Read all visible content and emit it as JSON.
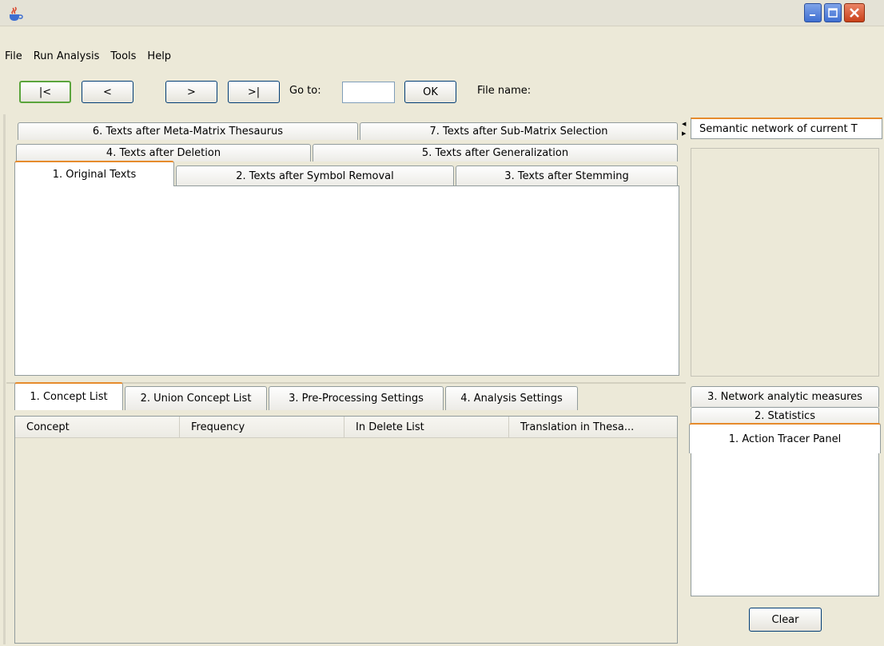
{
  "menu": [
    "File",
    "Run Analysis",
    "Tools",
    "Help"
  ],
  "toolbar": {
    "first": "|<",
    "prev": "<",
    "next": ">",
    "last": ">|",
    "goto_label": "Go to:",
    "goto_value": "",
    "ok": "OK",
    "file_label": "File name:"
  },
  "text_tabs": {
    "t1": "1. Original Texts",
    "t2": "2. Texts after Symbol Removal",
    "t3": "3. Texts after Stemming",
    "t4": "4. Texts after Deletion",
    "t5": "5. Texts after Generalization",
    "t6": "6. Texts after Meta-Matrix Thesaurus",
    "t7": "7. Texts after Sub-Matrix Selection"
  },
  "bottom_tabs": {
    "b1": "1. Concept List",
    "b2": "2. Union Concept List",
    "b3": "3. Pre-Processing Settings",
    "b4": "4. Analysis Settings"
  },
  "table_columns": [
    "Concept",
    "Frequency",
    "In Delete List",
    "Translation in Thesa..."
  ],
  "right_panel": {
    "semantic_tab": "Semantic network of current T",
    "tab3": "3. Network analytic measures",
    "tab2": "2. Statistics",
    "tab1": "1. Action Tracer Panel",
    "clear": "Clear"
  },
  "colors": {
    "window_bg": "#ECE9D8",
    "active_tab_accent": "#e68b2c",
    "close_button": "#c9411a"
  }
}
